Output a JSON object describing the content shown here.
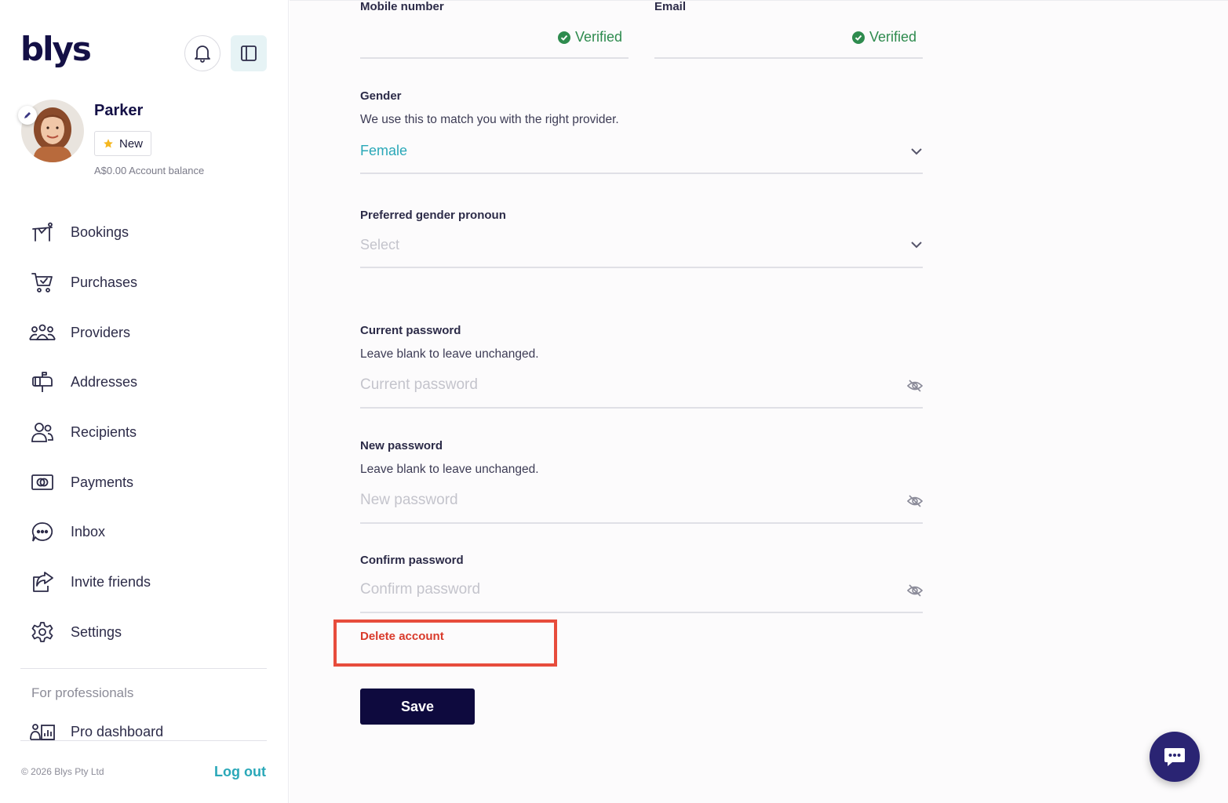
{
  "brand": {
    "logo_text": "blys"
  },
  "header": {
    "notifications_icon": "bell-icon",
    "panel_icon": "sidebar-toggle-icon"
  },
  "profile": {
    "name": "Parker",
    "tier_label": "New",
    "tier_icon": "star-icon",
    "balance_text": "A$0.00 Account balance"
  },
  "nav": {
    "items": [
      {
        "label": "Bookings",
        "icon": "massage-table-icon"
      },
      {
        "label": "Purchases",
        "icon": "cart-icon"
      },
      {
        "label": "Providers",
        "icon": "group-icon"
      },
      {
        "label": "Addresses",
        "icon": "mailbox-icon"
      },
      {
        "label": "Recipients",
        "icon": "recipients-icon"
      },
      {
        "label": "Payments",
        "icon": "payment-card-icon"
      },
      {
        "label": "Inbox",
        "icon": "chat-bubble-icon"
      },
      {
        "label": "Invite friends",
        "icon": "share-icon"
      },
      {
        "label": "Settings",
        "icon": "gear-icon"
      }
    ],
    "pro_section_label": "For professionals",
    "pro_dashboard_label": "Pro dashboard"
  },
  "footer": {
    "copyright": "© 2026 Blys Pty Ltd",
    "logout_label": "Log out"
  },
  "form": {
    "mobile": {
      "label": "Mobile number",
      "status": "Verified"
    },
    "email": {
      "label": "Email",
      "status": "Verified"
    },
    "gender": {
      "label": "Gender",
      "helper": "We use this to match you with the right provider.",
      "value": "Female"
    },
    "pronoun": {
      "label": "Preferred gender pronoun",
      "placeholder": "Select"
    },
    "current_password": {
      "label": "Current password",
      "helper": "Leave blank to leave unchanged.",
      "placeholder": "Current password"
    },
    "new_password": {
      "label": "New password",
      "helper": "Leave blank to leave unchanged.",
      "placeholder": "New password"
    },
    "confirm_password": {
      "label": "Confirm password",
      "placeholder": "Confirm password"
    },
    "delete_label": "Delete account",
    "save_label": "Save"
  },
  "colors": {
    "brand_navy": "#0e0a3e",
    "accent_teal": "#2aa8b8",
    "verified_green": "#2e8b4e",
    "danger_red": "#d93a2b",
    "highlight": "#e74c3c"
  }
}
